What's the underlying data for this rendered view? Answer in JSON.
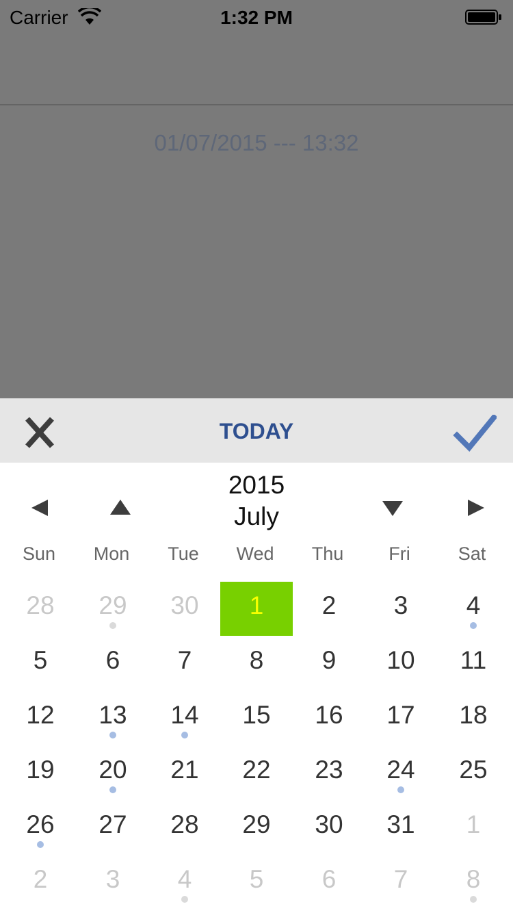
{
  "status_bar": {
    "carrier": "Carrier",
    "time": "1:32 PM"
  },
  "selected_datetime": "01/07/2015 --- 13:32",
  "picker": {
    "toolbar": {
      "today_label": "TODAY",
      "close_icon": "close-icon",
      "done_icon": "checkmark-icon"
    },
    "year": "2015",
    "month": "July",
    "weekdays": [
      "Sun",
      "Mon",
      "Tue",
      "Wed",
      "Thu",
      "Fri",
      "Sat"
    ],
    "colors": {
      "selected_bg": "#78d000",
      "selected_text": "#f7ff00",
      "event_dot": "#a6bde3",
      "event_dot_out": "#dadada",
      "toolbar_accent": "#2e4f8f"
    },
    "days": [
      {
        "label": "28",
        "in_month": false,
        "dot": false
      },
      {
        "label": "29",
        "in_month": false,
        "dot": true
      },
      {
        "label": "30",
        "in_month": false,
        "dot": false
      },
      {
        "label": "1",
        "in_month": true,
        "dot": false,
        "selected": true
      },
      {
        "label": "2",
        "in_month": true,
        "dot": false
      },
      {
        "label": "3",
        "in_month": true,
        "dot": false
      },
      {
        "label": "4",
        "in_month": true,
        "dot": true
      },
      {
        "label": "5",
        "in_month": true,
        "dot": false
      },
      {
        "label": "6",
        "in_month": true,
        "dot": false
      },
      {
        "label": "7",
        "in_month": true,
        "dot": false
      },
      {
        "label": "8",
        "in_month": true,
        "dot": false
      },
      {
        "label": "9",
        "in_month": true,
        "dot": false
      },
      {
        "label": "10",
        "in_month": true,
        "dot": false
      },
      {
        "label": "11",
        "in_month": true,
        "dot": false
      },
      {
        "label": "12",
        "in_month": true,
        "dot": false
      },
      {
        "label": "13",
        "in_month": true,
        "dot": true
      },
      {
        "label": "14",
        "in_month": true,
        "dot": true
      },
      {
        "label": "15",
        "in_month": true,
        "dot": false
      },
      {
        "label": "16",
        "in_month": true,
        "dot": false
      },
      {
        "label": "17",
        "in_month": true,
        "dot": false
      },
      {
        "label": "18",
        "in_month": true,
        "dot": false
      },
      {
        "label": "19",
        "in_month": true,
        "dot": false
      },
      {
        "label": "20",
        "in_month": true,
        "dot": true
      },
      {
        "label": "21",
        "in_month": true,
        "dot": false
      },
      {
        "label": "22",
        "in_month": true,
        "dot": false
      },
      {
        "label": "23",
        "in_month": true,
        "dot": false
      },
      {
        "label": "24",
        "in_month": true,
        "dot": true
      },
      {
        "label": "25",
        "in_month": true,
        "dot": false
      },
      {
        "label": "26",
        "in_month": true,
        "dot": true
      },
      {
        "label": "27",
        "in_month": true,
        "dot": false
      },
      {
        "label": "28",
        "in_month": true,
        "dot": false
      },
      {
        "label": "29",
        "in_month": true,
        "dot": false
      },
      {
        "label": "30",
        "in_month": true,
        "dot": false
      },
      {
        "label": "31",
        "in_month": true,
        "dot": false
      },
      {
        "label": "1",
        "in_month": false,
        "dot": false
      },
      {
        "label": "2",
        "in_month": false,
        "dot": false
      },
      {
        "label": "3",
        "in_month": false,
        "dot": false
      },
      {
        "label": "4",
        "in_month": false,
        "dot": true
      },
      {
        "label": "5",
        "in_month": false,
        "dot": false
      },
      {
        "label": "6",
        "in_month": false,
        "dot": false
      },
      {
        "label": "7",
        "in_month": false,
        "dot": false
      },
      {
        "label": "8",
        "in_month": false,
        "dot": true
      }
    ]
  }
}
